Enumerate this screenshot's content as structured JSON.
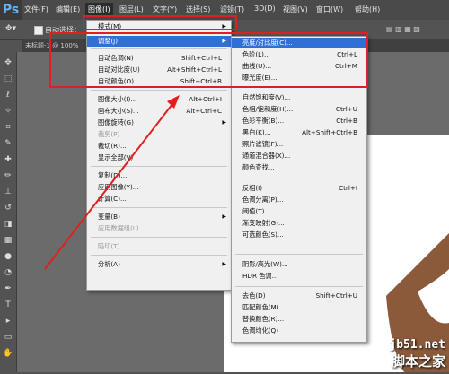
{
  "app": {
    "logo": "Ps"
  },
  "menubar": [
    {
      "label": "文件(F)"
    },
    {
      "label": "编辑(E)"
    },
    {
      "label": "图像(I)",
      "active": true
    },
    {
      "label": "图层(L)"
    },
    {
      "label": "文字(Y)"
    },
    {
      "label": "选择(S)"
    },
    {
      "label": "滤镜(T)"
    },
    {
      "label": "3D(D)"
    },
    {
      "label": "视图(V)"
    },
    {
      "label": "窗口(W)"
    },
    {
      "label": "帮助(H)"
    }
  ],
  "options": {
    "auto_select": "自动选择：",
    "tab_label": "未标题-1 @ 100%"
  },
  "image_menu": [
    {
      "label": "模式(M)",
      "submenu": true
    },
    {
      "sep": true
    },
    {
      "label": "调整(J)",
      "submenu": true,
      "highlight": true
    },
    {
      "sep": true
    },
    {
      "label": "自动色调(N)",
      "shortcut": "Shift+Ctrl+L"
    },
    {
      "label": "自动对比度(U)",
      "shortcut": "Alt+Shift+Ctrl+L"
    },
    {
      "label": "自动颜色(O)",
      "shortcut": "Shift+Ctrl+B"
    },
    {
      "sep": true
    },
    {
      "label": "图像大小(I)...",
      "shortcut": "Alt+Ctrl+I"
    },
    {
      "label": "画布大小(S)...",
      "shortcut": "Alt+Ctrl+C"
    },
    {
      "label": "图像旋转(G)",
      "submenu": true
    },
    {
      "label": "裁剪(P)",
      "disabled": true
    },
    {
      "label": "裁切(R)..."
    },
    {
      "label": "显示全部(V)"
    },
    {
      "sep": true
    },
    {
      "label": "复制(D)..."
    },
    {
      "label": "应用图像(Y)..."
    },
    {
      "label": "计算(C)..."
    },
    {
      "sep": true
    },
    {
      "label": "变量(B)",
      "submenu": true
    },
    {
      "label": "应用数据组(L)...",
      "disabled": true
    },
    {
      "sep": true
    },
    {
      "label": "陷印(T)...",
      "disabled": true
    },
    {
      "sep": true
    },
    {
      "label": "分析(A)",
      "submenu": true
    }
  ],
  "adjust_menu": [
    {
      "label": "亮度/对比度(C)...",
      "highlight": true
    },
    {
      "label": "色阶(L)...",
      "shortcut": "Ctrl+L"
    },
    {
      "label": "曲线(U)...",
      "shortcut": "Ctrl+M"
    },
    {
      "label": "曝光度(E)..."
    },
    {
      "sep": true
    },
    {
      "label": "自然饱和度(V)..."
    },
    {
      "label": "色相/饱和度(H)...",
      "shortcut": "Ctrl+U"
    },
    {
      "label": "色彩平衡(B)...",
      "shortcut": "Ctrl+B"
    },
    {
      "label": "黑白(K)...",
      "shortcut": "Alt+Shift+Ctrl+B"
    },
    {
      "label": "照片滤镜(F)..."
    },
    {
      "label": "通道混合器(X)..."
    },
    {
      "label": "颜色查找..."
    },
    {
      "sep": true
    },
    {
      "label": "反相(I)",
      "shortcut": "Ctrl+I"
    },
    {
      "label": "色调分离(P)..."
    },
    {
      "label": "阈值(T)..."
    },
    {
      "label": "渐变映射(G)..."
    },
    {
      "label": "可选颜色(S)..."
    },
    {
      "sep": true
    },
    {
      "label": "阴影/高光(W)..."
    },
    {
      "label": "HDR 色调..."
    },
    {
      "sep": true
    },
    {
      "label": "去色(D)",
      "shortcut": "Shift+Ctrl+U"
    },
    {
      "label": "匹配颜色(M)..."
    },
    {
      "label": "替换颜色(R)..."
    },
    {
      "label": "色调均化(Q)"
    }
  ],
  "watermark": {
    "site": "jb51.net",
    "name": "脚本之家"
  },
  "colors": {
    "highlight": "#2f6fd6",
    "annotation": "#e02020",
    "menu_bg": "#f0f0f0"
  }
}
